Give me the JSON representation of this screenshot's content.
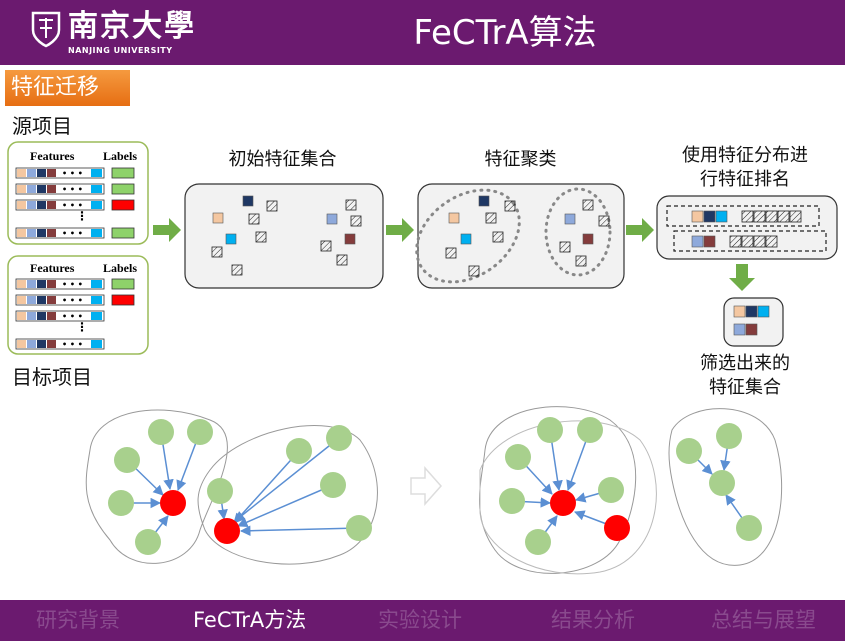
{
  "header": {
    "university_cn": "南京大學",
    "university_en": "NANJING UNIVERSITY",
    "title": "FeCTrA算法"
  },
  "section_tab": "特征迁移",
  "source_label": "源项目",
  "target_label": "目标项目",
  "table_headers": {
    "features": "Features",
    "labels": "Labels"
  },
  "stages": {
    "initial": "初始特征集合",
    "cluster": "特征聚类",
    "rank_line1": "使用特征分布进",
    "rank_line2": "行特征排名",
    "selected_line1": "筛选出来的",
    "selected_line2": "特征集合"
  },
  "colors": {
    "purple": "#6b1a6f",
    "orange": "#ee7d22",
    "arrow_green": "#70ad47",
    "node_green": "#a8d08d",
    "node_red": "#ff0000",
    "edge_blue": "#5b8fd3",
    "label_green": "#8ed26a",
    "label_red": "#ff0000"
  },
  "nav": [
    {
      "label": "研究背景",
      "active": false
    },
    {
      "label": "FeCTrA方法",
      "active": true
    },
    {
      "label": "实验设计",
      "active": false
    },
    {
      "label": "结果分析",
      "active": false
    },
    {
      "label": "总结与展望",
      "active": false
    }
  ]
}
